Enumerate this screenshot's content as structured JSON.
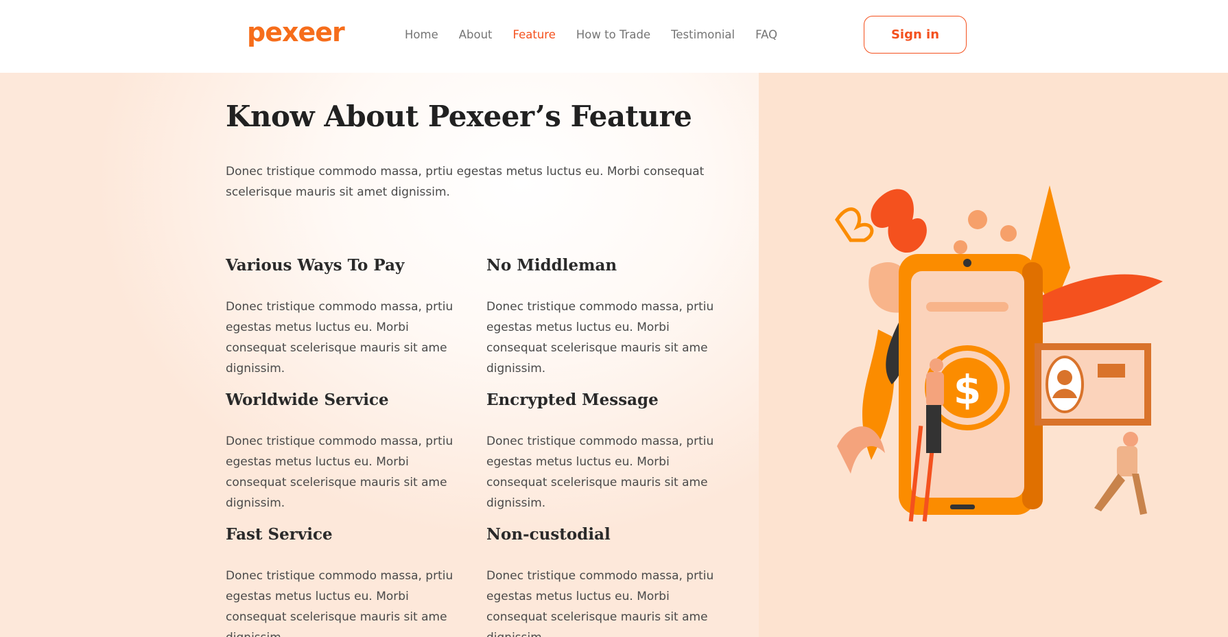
{
  "header": {
    "logo": "pexeer",
    "nav": [
      "Home",
      "About",
      "Feature",
      "How to Trade",
      "Testimonial",
      "FAQ"
    ],
    "active_nav": "Feature",
    "signin_label": "Sign in"
  },
  "colors": {
    "accent": "#f4511e",
    "orange": "#fb8c00",
    "right_bg": "#fde3d0"
  },
  "main": {
    "title": "Know About Pexeer’s Feature",
    "intro": "Donec tristique commodo massa, prtiu egestas metus luctus eu. Morbi consequat scelerisque mauris sit amet dignissim.",
    "features": [
      {
        "title": "Various Ways To Pay",
        "text": "Donec tristique commodo massa, prtiu egestas metus luctus eu. Morbi consequat scelerisque mauris sit ame dignissim."
      },
      {
        "title": "No Middleman",
        "text": "Donec tristique commodo massa, prtiu egestas metus luctus eu. Morbi consequat scelerisque mauris sit ame dignissim."
      },
      {
        "title": "Worldwide Service",
        "text": "Donec tristique commodo massa, prtiu egestas metus luctus eu. Morbi consequat scelerisque mauris sit ame dignissim."
      },
      {
        "title": "Encrypted Message",
        "text": "Donec tristique commodo massa, prtiu egestas metus luctus eu. Morbi consequat scelerisque mauris sit ame dignissim."
      },
      {
        "title": "Fast Service",
        "text": "Donec tristique commodo massa, prtiu egestas metus luctus eu. Morbi consequat scelerisque mauris sit ame dignissim."
      },
      {
        "title": "Non-custodial",
        "text": "Donec tristique commodo massa, prtiu egestas metus luctus eu. Morbi consequat scelerisque mauris sit ame dignissim."
      }
    ]
  },
  "illustration": {
    "icon": "phone-payment-illustration",
    "symbol": "$"
  }
}
